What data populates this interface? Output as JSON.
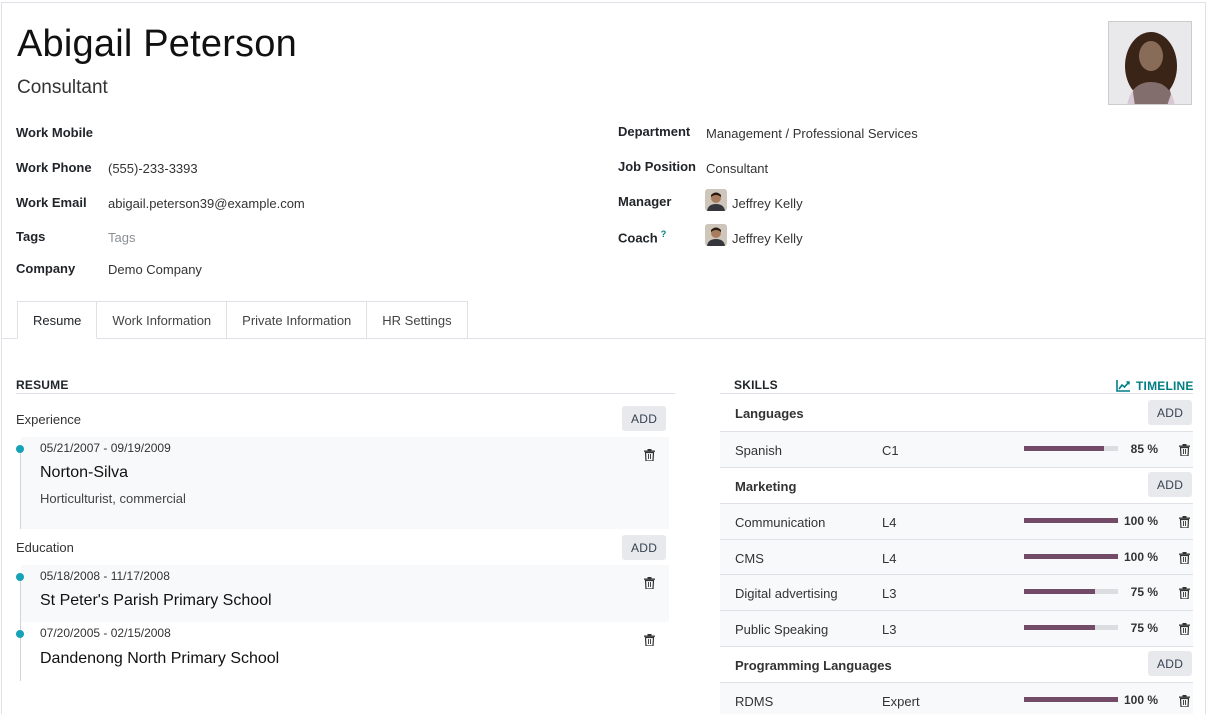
{
  "employee": {
    "name": "Abigail Peterson",
    "job_title": "Consultant"
  },
  "fields_left": {
    "work_mobile_label": "Work Mobile",
    "work_mobile_value": "",
    "work_phone_label": "Work Phone",
    "work_phone_value": "(555)-233-3393",
    "work_email_label": "Work Email",
    "work_email_value": "abigail.peterson39@example.com",
    "tags_label": "Tags",
    "tags_placeholder": "Tags",
    "company_label": "Company",
    "company_value": "Demo Company"
  },
  "fields_right": {
    "department_label": "Department",
    "department_value": "Management / Professional Services",
    "job_position_label": "Job Position",
    "job_position_value": "Consultant",
    "manager_label": "Manager",
    "manager_value": "Jeffrey Kelly",
    "coach_label": "Coach",
    "coach_help": "?",
    "coach_value": "Jeffrey Kelly"
  },
  "tabs": [
    {
      "label": "Resume",
      "active": true
    },
    {
      "label": "Work Information",
      "active": false
    },
    {
      "label": "Private Information",
      "active": false
    },
    {
      "label": "HR Settings",
      "active": false
    }
  ],
  "resume": {
    "heading": "RESUME",
    "add_label": "ADD",
    "experience_label": "Experience",
    "education_label": "Education",
    "experience": [
      {
        "dates": "05/21/2007 - 09/19/2009",
        "title": "Norton-Silva",
        "description": "Horticulturist, commercial"
      }
    ],
    "education": [
      {
        "dates": "05/18/2008 - 11/17/2008",
        "title": "St Peter's Parish Primary School"
      },
      {
        "dates": "07/20/2005 - 02/15/2008",
        "title": "Dandenong North Primary School"
      }
    ]
  },
  "skills": {
    "heading": "SKILLS",
    "timeline_label": "TIMELINE",
    "add_label": "ADD",
    "groups": [
      {
        "name": "Languages",
        "items": [
          {
            "name": "Spanish",
            "level": "C1",
            "progress": 85,
            "pct_label": "85 %"
          }
        ]
      },
      {
        "name": "Marketing",
        "items": [
          {
            "name": "Communication",
            "level": "L4",
            "progress": 100,
            "pct_label": "100 %"
          },
          {
            "name": "CMS",
            "level": "L4",
            "progress": 100,
            "pct_label": "100 %"
          },
          {
            "name": "Digital advertising",
            "level": "L3",
            "progress": 75,
            "pct_label": "75 %"
          },
          {
            "name": "Public Speaking",
            "level": "L3",
            "progress": 75,
            "pct_label": "75 %"
          }
        ]
      },
      {
        "name": "Programming Languages",
        "items": [
          {
            "name": "RDMS",
            "level": "Expert",
            "progress": 100,
            "pct_label": "100 %"
          }
        ]
      }
    ]
  },
  "colors": {
    "accent": "#017e84",
    "bullet": "#17a2b8",
    "progress": "#714b67"
  }
}
